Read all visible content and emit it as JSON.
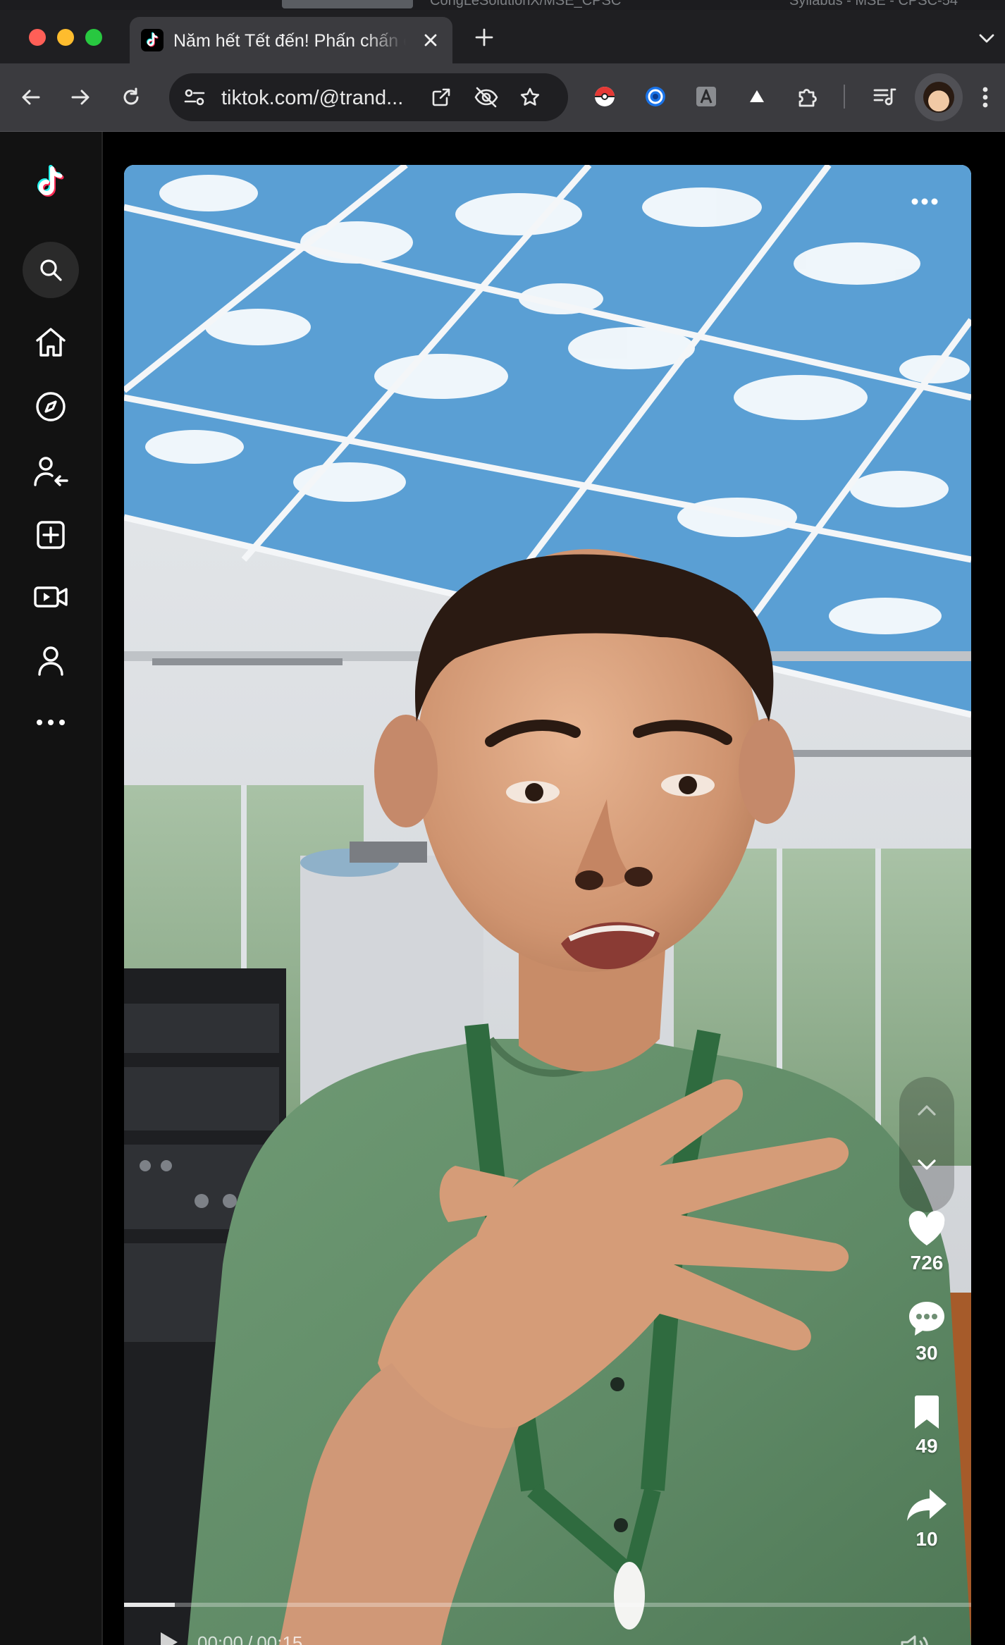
{
  "browser": {
    "background_tabs": [
      "CongLeSolutionX/MSE_CPSC",
      "Syllabus - MSE - CPSC-54"
    ],
    "active_tab": {
      "title": "Năm hết Tết đến! Phấn chấn c",
      "favicon": "tiktok-icon"
    },
    "url": "tiktok.com/@trand...",
    "icons": {
      "back": "arrow-left-icon",
      "forward": "arrow-right-icon",
      "reload": "reload-icon",
      "site_info": "tune-icon",
      "open_in_app": "open-external-icon",
      "tracking": "eye-off-icon",
      "bookmark": "star-icon",
      "extensions": [
        "pokeball-icon",
        "swirl-icon",
        "pdf-icon",
        "triangle-icon",
        "puzzle-icon"
      ],
      "media": "queue-music-icon",
      "menu": "kebab-menu-icon"
    },
    "colors": {
      "tab_bar": "#1f1f22",
      "toolbar": "#3b3b3f",
      "omnibox": "#1f1f22"
    }
  },
  "sidebar": {
    "items": [
      {
        "name": "tiktok-logo",
        "icon": "tiktok-icon"
      },
      {
        "name": "search",
        "icon": "search-icon"
      },
      {
        "name": "home",
        "icon": "home-icon"
      },
      {
        "name": "explore",
        "icon": "compass-icon"
      },
      {
        "name": "following",
        "icon": "user-follow-icon"
      },
      {
        "name": "upload",
        "icon": "plus-square-icon"
      },
      {
        "name": "live",
        "icon": "video-camera-icon"
      },
      {
        "name": "profile",
        "icon": "user-icon"
      },
      {
        "name": "more",
        "icon": "more-horizontal-icon"
      }
    ]
  },
  "video": {
    "actions": {
      "likes": "726",
      "comments": "30",
      "saves": "49",
      "shares": "10"
    },
    "time_current": "00:00",
    "time_total": "00:15",
    "progress": 0.06,
    "colors": {
      "accent_pink": "#fe2c55",
      "accent_cyan": "#25f4ee"
    }
  }
}
